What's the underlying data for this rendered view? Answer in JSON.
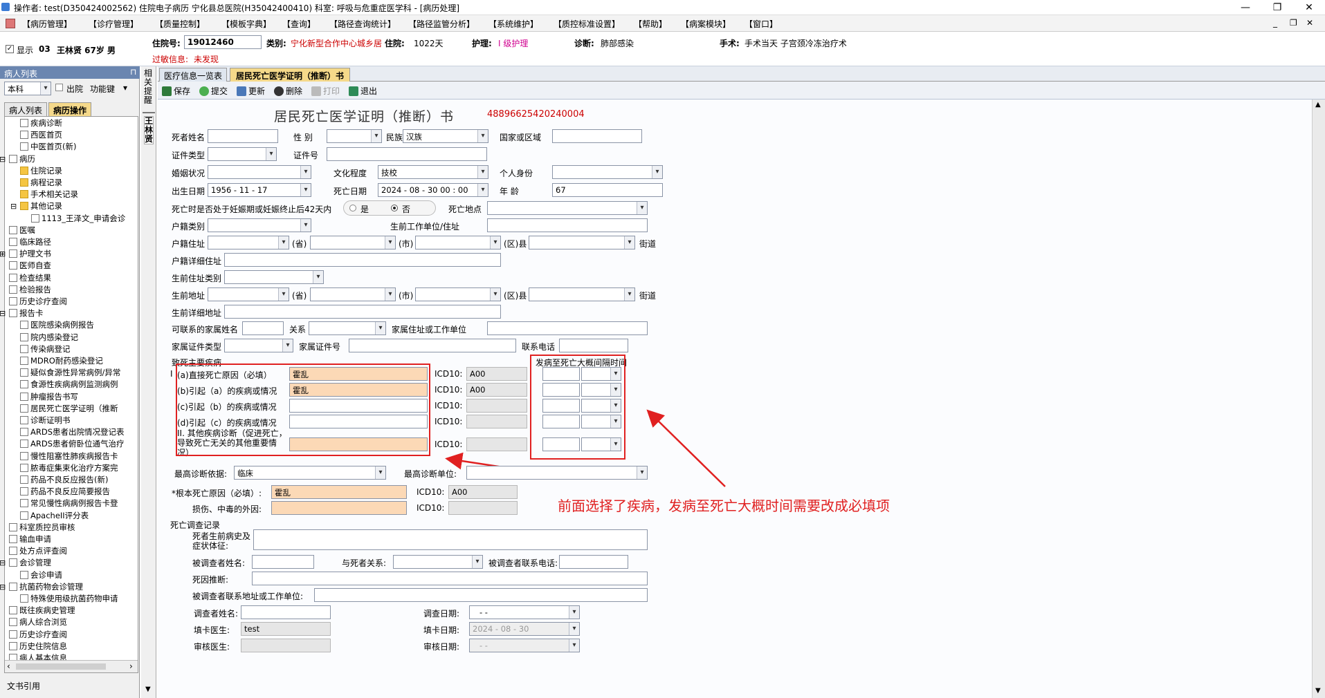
{
  "titlebar": {
    "title": "操作者: test(D350424002562) 住院电子病历  宁化县总医院(H35042400410)  科室: 呼吸与危重症医学科 - [病历处理]"
  },
  "menu": [
    "【病历管理】",
    "【诊疗管理】",
    "【质量控制】",
    "【模板字典】",
    "【查询】",
    "【路径查询统计】",
    "【路径监管分析】",
    "【系统维护】",
    "【质控标准设置】",
    "【帮助】",
    "【病案模块】",
    "【窗口】"
  ],
  "patient_header": {
    "show_label": "显示",
    "bed": "03",
    "name_info": "王林贤 67岁 男",
    "admit_no_label": "住院号:",
    "admit_no": "19012460",
    "category_label": "类别:",
    "category": "宁化新型合作中心城乡居",
    "days_label": "住院:",
    "days": "1022天",
    "nursing_label": "护理:",
    "nursing": "I 级护理",
    "diag_label": "诊断:",
    "diag": "肺部感染",
    "surgery_label": "手术:",
    "surgery": "手术当天 子宫颈冷冻治疗术",
    "allergy_label": "过敏信息:",
    "allergy": "未发现"
  },
  "left": {
    "pane_title": "病人列表",
    "pin": "♀",
    "dept": "本科",
    "discharged_label": "出院",
    "function_key": "功能键",
    "tabs": [
      "病人列表",
      "病历操作"
    ],
    "tree": [
      {
        "label": "疾病诊断",
        "level": 1
      },
      {
        "label": "西医首页",
        "level": 1
      },
      {
        "label": "中医首页(新)",
        "level": 1
      },
      {
        "label": "病历",
        "level": 0,
        "toggle": "⊟"
      },
      {
        "label": "住院记录",
        "level": 1,
        "folder": true
      },
      {
        "label": "病程记录",
        "level": 1,
        "folder": true
      },
      {
        "label": "手术相关记录",
        "level": 1,
        "folder": true
      },
      {
        "label": "其他记录",
        "level": 1,
        "folder": true,
        "toggle": "⊟"
      },
      {
        "label": "1113_王泽文_申请会诊",
        "level": 2
      },
      {
        "label": "医嘱",
        "level": 0
      },
      {
        "label": "临床路径",
        "level": 0
      },
      {
        "label": "护理文书",
        "level": 0,
        "toggle": "⊞"
      },
      {
        "label": "医师自查",
        "level": 0
      },
      {
        "label": "检查结果",
        "level": 0
      },
      {
        "label": "检验报告",
        "level": 0
      },
      {
        "label": "历史诊疗查阅",
        "level": 0
      },
      {
        "label": "报告卡",
        "level": 0,
        "toggle": "⊟"
      },
      {
        "label": "医院感染病例报告",
        "level": 1
      },
      {
        "label": "院内感染登记",
        "level": 1
      },
      {
        "label": "传染病登记",
        "level": 1
      },
      {
        "label": "MDRO耐药感染登记",
        "level": 1
      },
      {
        "label": "疑似食源性异常病例/异常",
        "level": 1
      },
      {
        "label": "食源性疾病病例监测病例",
        "level": 1
      },
      {
        "label": "肿瘤报告书写",
        "level": 1
      },
      {
        "label": "居民死亡医学证明（推断",
        "level": 1
      },
      {
        "label": "诊断证明书",
        "level": 1
      },
      {
        "label": "ARDS患者出院情况登记表",
        "level": 1
      },
      {
        "label": "ARDS患者俯卧位通气治疗",
        "level": 1
      },
      {
        "label": "慢性阻塞性肺疾病报告卡",
        "level": 1
      },
      {
        "label": "脓毒症集束化治疗方案完",
        "level": 1
      },
      {
        "label": "药品不良反应报告(新)",
        "level": 1
      },
      {
        "label": "药品不良反应简要报告",
        "level": 1
      },
      {
        "label": "常见慢性病病例报告卡登",
        "level": 1
      },
      {
        "label": "ApacheII评分表",
        "level": 1
      },
      {
        "label": "科室质控员审核",
        "level": 0
      },
      {
        "label": "输血申请",
        "level": 0
      },
      {
        "label": "处方点评查阅",
        "level": 0
      },
      {
        "label": "会诊管理",
        "level": 0,
        "toggle": "⊟"
      },
      {
        "label": "会诊申请",
        "level": 1
      },
      {
        "label": "抗菌药物会诊管理",
        "level": 0,
        "toggle": "⊟"
      },
      {
        "label": "特殊使用级抗菌药物申请",
        "level": 1
      },
      {
        "label": "既往疾病史管理",
        "level": 0
      },
      {
        "label": "病人综合浏览",
        "level": 0
      },
      {
        "label": "历史诊疗查阅",
        "level": 0
      },
      {
        "label": "历史住院信息",
        "level": 0
      },
      {
        "label": "病人基本信息",
        "level": 0
      }
    ],
    "bottom": "文书引用"
  },
  "vstrip": {
    "top": "相关提醒",
    "bottom": "王林贤"
  },
  "doc_tabs": [
    "医疗信息一览表",
    "居民死亡医学证明（推断）书"
  ],
  "toolbar": [
    "保存",
    "提交",
    "更新",
    "删除",
    "打印",
    "退出"
  ],
  "form": {
    "title": "居民死亡医学证明（推断）书",
    "serial": "48896625420240004",
    "fields": {
      "name_label": "死者姓名",
      "sex_label": "性  别",
      "ethnic_label": "民族",
      "ethnic": "汉族",
      "country_label": "国家或区域",
      "idtype_label": "证件类型",
      "idno_label": "证件号",
      "marital_label": "婚姻状况",
      "edu_label": "文化程度",
      "edu": "技校",
      "identity_label": "个人身份",
      "birth_label": "出生日期",
      "birth": "1956 - 11 - 17",
      "death_date_label": "死亡日期",
      "death_date": "2024 - 08 - 30   00 : 00",
      "age_label": "年    龄",
      "age": "67",
      "pregnant_label": "死亡时是否处于妊娠期或妊娠终止后42天内",
      "yes": "是",
      "no": "否",
      "death_place_label": "死亡地点",
      "hukou_type_label": "户籍类别",
      "work_unit_label": "生前工作单位/住址",
      "hukou_addr_label": "户籍住址",
      "prov": "(省)",
      "city": "(市)",
      "county": "(区)县",
      "street": "街道",
      "hukou_detail_label": "户籍详细住址",
      "live_type_label": "生前住址类别",
      "live_addr_label": "生前地址",
      "live_detail_label": "生前详细地址",
      "contact_label": "可联系的家属姓名",
      "relation_label": "关系",
      "family_addr_label": "家属住址或工作单位",
      "family_id_type_label": "家属证件类型",
      "family_id_label": "家属证件号",
      "phone_label": "联系电话"
    },
    "cause": {
      "section_label": "致死主要疾病",
      "interval_header": "发病至死亡大概间隔时间",
      "roman_i": "I",
      "rows": [
        {
          "label": "(a)直接死亡原因（必填）",
          "value": "霍乱",
          "icd": "A00"
        },
        {
          "label": "(b)引起（a）的疾病或情况",
          "value": "霍乱",
          "icd": "A00"
        },
        {
          "label": "(c)引起（b）的疾病或情况",
          "value": "",
          "icd": ""
        },
        {
          "label": "(d)引起（c）的疾病或情况",
          "value": "",
          "icd": ""
        }
      ],
      "other_label": "II. 其他疾病诊断（促进死亡，导致死亡无关的其他重要情况）",
      "icd_label": "ICD10:"
    },
    "highest": {
      "basis_label": "最高诊断依据:",
      "basis": "临床",
      "unit_label": "最高诊断单位:"
    },
    "root": {
      "label": "*根本死亡原因（必填）:",
      "value": "霍乱",
      "icd": "A00",
      "injury_label": "损伤、中毒的外因:",
      "icd_label": "ICD10:"
    },
    "survey": {
      "section_label": "死亡调查记录",
      "history_label": "死者生前病史及症状体征:",
      "surveyed_name_label": "被调查者姓名:",
      "relation_label": "与死者关系:",
      "surveyed_phone_label": "被调查者联系电话:",
      "cause_infer_label": "死因推断:",
      "surveyed_addr_label": "被调查者联系地址或工作单位:",
      "investigator_label": "调查者姓名:",
      "survey_date_label": "调查日期:",
      "survey_date": "-   -",
      "doctor_label": "填卡医生:",
      "doctor": "test",
      "fill_date_label": "填卡日期:",
      "fill_date": "2024 - 08 - 30",
      "reviewer_label": "审核医生:",
      "review_date_label": "审核日期:",
      "review_date": "-   -"
    }
  },
  "annotation": "前面选择了疾病，发病至死亡大概时间需要改成必填项",
  "colors": {
    "required": "#fcd9b6",
    "annotation": "#e02020",
    "header_red": "#c00000",
    "nursing": "#d0008f"
  }
}
